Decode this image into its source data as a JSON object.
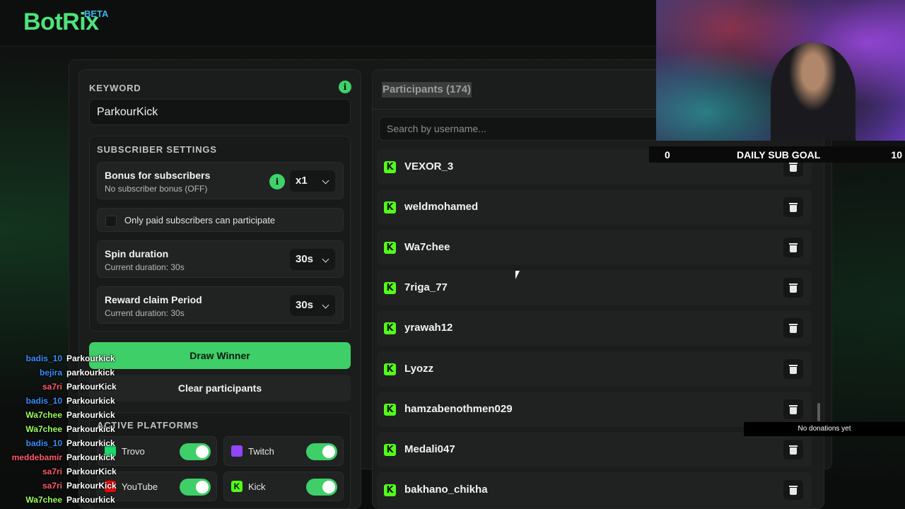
{
  "header": {
    "logo": "BotRix",
    "badge": "BETA"
  },
  "keyword": {
    "label": "KEYWORD",
    "value": "ParkourKick"
  },
  "subscriber_settings": {
    "title": "SUBSCRIBER SETTINGS",
    "bonus": {
      "title": "Bonus for subscribers",
      "subtitle": "No subscriber bonus (OFF)",
      "value": "x1"
    },
    "paid_only": {
      "label": "Only paid subscribers can participate",
      "checked": false
    },
    "spin": {
      "title": "Spin duration",
      "subtitle": "Current duration: 30s",
      "value": "30s"
    },
    "reward": {
      "title": "Reward claim Period",
      "subtitle": "Current duration: 30s",
      "value": "30s"
    }
  },
  "actions": {
    "draw": "Draw Winner",
    "clear": "Clear participants"
  },
  "platforms": {
    "title": "ACTIVE PLATFORMS",
    "items": [
      {
        "name": "Trovo",
        "enabled": true,
        "icon": "trovo-icon",
        "color": "#1bd96a"
      },
      {
        "name": "Twitch",
        "enabled": true,
        "icon": "twitch-icon",
        "color": "#9146ff"
      },
      {
        "name": "YouTube",
        "enabled": true,
        "icon": "youtube-icon",
        "color": "#ff0000"
      },
      {
        "name": "Kick",
        "enabled": true,
        "icon": "kick-icon",
        "color": "#53fc18"
      }
    ]
  },
  "participants": {
    "title": "Participants (174)",
    "search_placeholder": "Search by username...",
    "list": [
      "VEXOR_3",
      "weldmohamed",
      "Wa7chee",
      "7riga_77",
      "yrawah12",
      "Lyozz",
      "hamzabenothmen029",
      "Medali047",
      "bakhano_chikha"
    ]
  },
  "overlay": {
    "sub_goal": {
      "current": "0",
      "title": "DAILY SUB GOAL",
      "target": "10"
    },
    "donations": "No donations yet",
    "chat": [
      {
        "user": "badis_10",
        "msg": "Parkourkick",
        "color": "#3b8cff"
      },
      {
        "user": "bejira",
        "msg": "parkourkick",
        "color": "#3b8cff"
      },
      {
        "user": "sa7ri",
        "msg": "ParkourKick",
        "color": "#ff5a6a"
      },
      {
        "user": "badis_10",
        "msg": "Parkourkick",
        "color": "#3b8cff"
      },
      {
        "user": "Wa7chee",
        "msg": "Parkourkick",
        "color": "#9cff5a"
      },
      {
        "user": "Wa7chee",
        "msg": "Parkourkick",
        "color": "#9cff5a"
      },
      {
        "user": "badis_10",
        "msg": "Parkourkick",
        "color": "#3b8cff"
      },
      {
        "user": "meddebamir",
        "msg": "Parkourkick",
        "color": "#ff5a6a"
      },
      {
        "user": "sa7ri",
        "msg": "ParkourKick",
        "color": "#ff5a6a"
      },
      {
        "user": "sa7ri",
        "msg": "ParkourKick",
        "color": "#ff5a6a"
      },
      {
        "user": "Wa7chee",
        "msg": "Parkourkick",
        "color": "#9cff5a"
      }
    ]
  },
  "colors": {
    "accent": "#3fcf68",
    "kick": "#53fc18",
    "beta": "#35b8f0"
  }
}
